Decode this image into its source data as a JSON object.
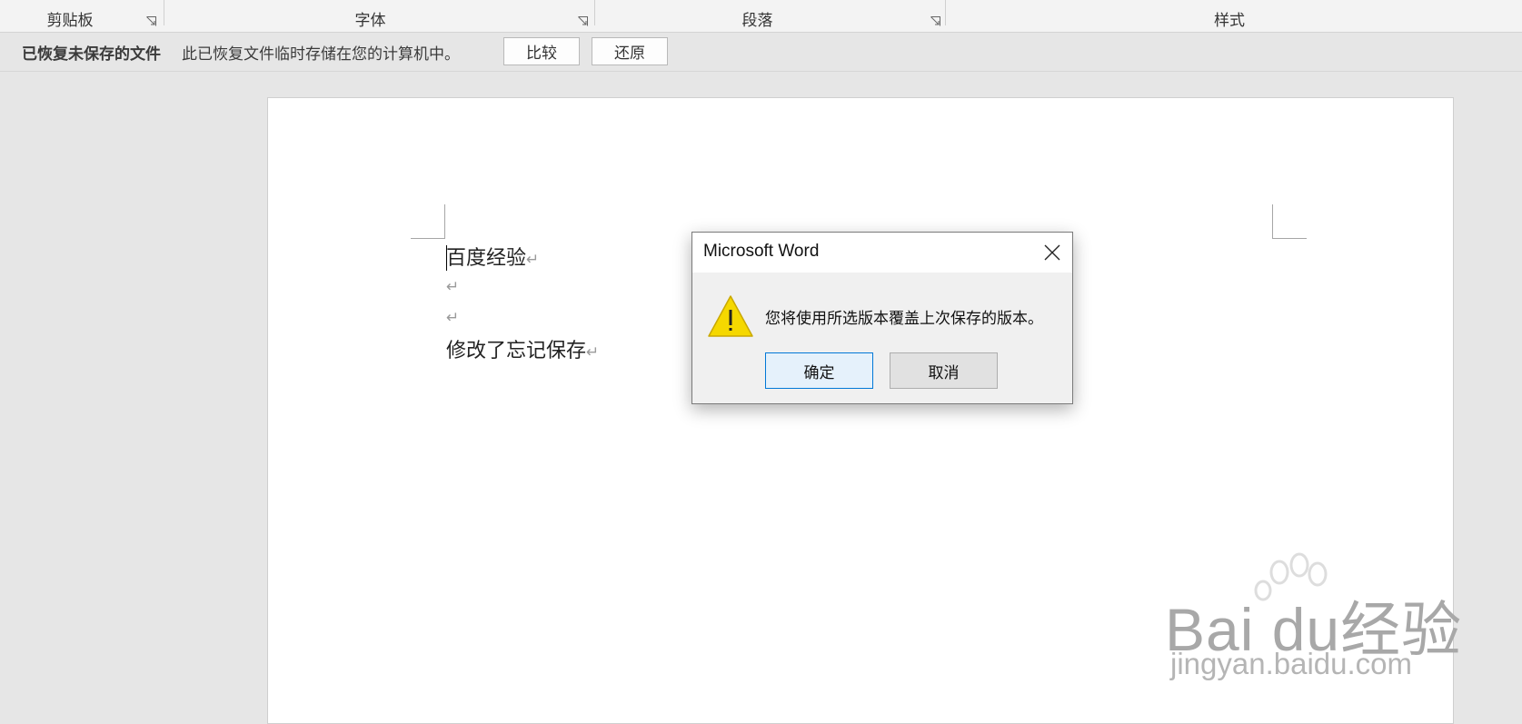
{
  "ribbon": {
    "groups": [
      {
        "label": "剪贴板"
      },
      {
        "label": "字体"
      },
      {
        "label": "段落"
      },
      {
        "label": "样式"
      }
    ]
  },
  "message_bar": {
    "title": "已恢复未保存的文件",
    "text": "此已恢复文件临时存储在您的计算机中。",
    "compare_label": "比较",
    "restore_label": "还原"
  },
  "document": {
    "paragraphs": [
      "百度经验",
      "",
      "",
      "修改了忘记保存"
    ],
    "paragraph_mark": "↵"
  },
  "dialog": {
    "title": "Microsoft Word",
    "message": "您将使用所选版本覆盖上次保存的版本。",
    "ok_label": "确定",
    "cancel_label": "取消",
    "icon": "warning-icon"
  },
  "watermark": {
    "brand": "Bai  du经验",
    "url": "jingyan.baidu.com"
  },
  "colors": {
    "accent": "#0078d7",
    "warning": "#f5d800"
  }
}
